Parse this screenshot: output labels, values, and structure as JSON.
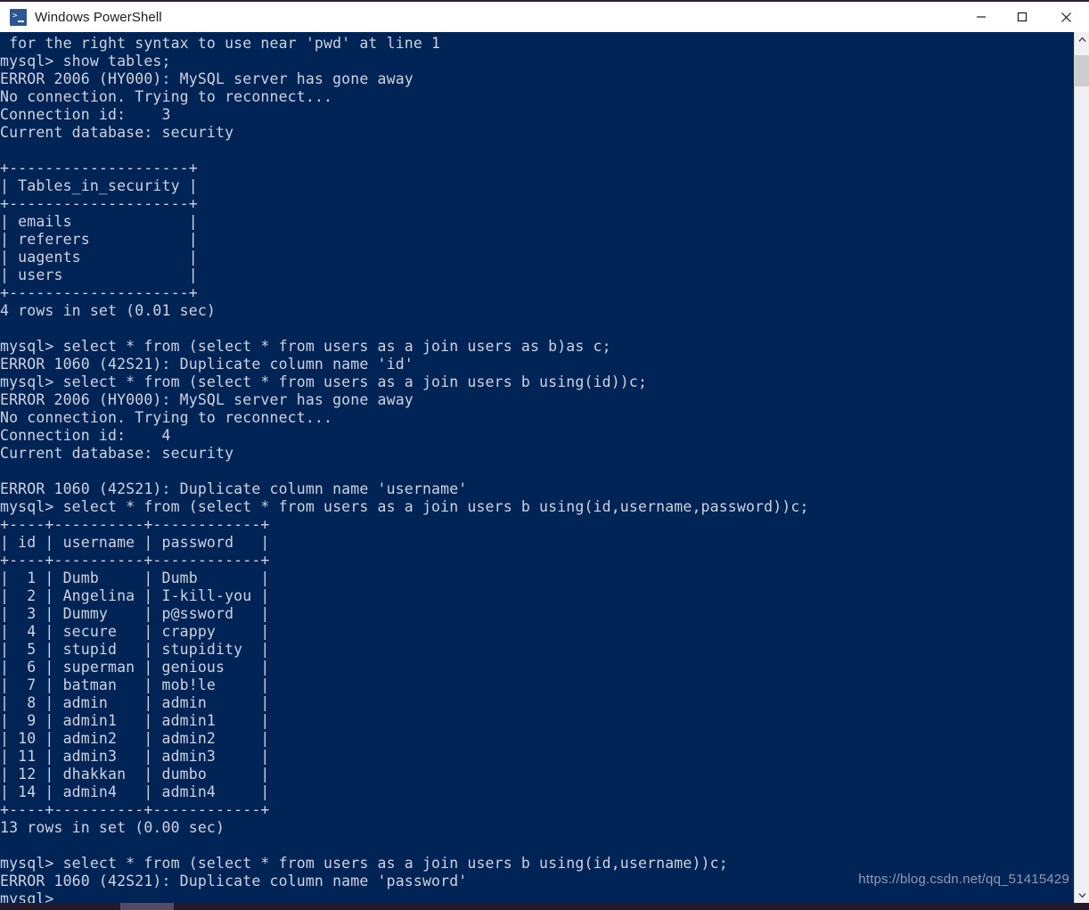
{
  "window": {
    "title": "Windows PowerShell",
    "icon": "powershell-icon",
    "controls": {
      "minimize": "—",
      "maximize": "□",
      "close": "✕"
    },
    "colors": {
      "console_background": "#012456",
      "console_text": "#cdd3de",
      "titlebar_background": "#ffffff",
      "icon_blue": "#2b5797"
    }
  },
  "console": {
    "lines": [
      " for the right syntax to use near 'pwd' at line 1",
      "mysql> show tables;",
      "ERROR 2006 (HY000): MySQL server has gone away",
      "No connection. Trying to reconnect...",
      "Connection id:    3",
      "Current database: security",
      "",
      "+--------------------+",
      "| Tables_in_security |",
      "+--------------------+",
      "| emails             |",
      "| referers           |",
      "| uagents            |",
      "| users              |",
      "+--------------------+",
      "4 rows in set (0.01 sec)",
      "",
      "mysql> select * from (select * from users as a join users as b)as c;",
      "ERROR 1060 (42S21): Duplicate column name 'id'",
      "mysql> select * from (select * from users as a join users b using(id))c;",
      "ERROR 2006 (HY000): MySQL server has gone away",
      "No connection. Trying to reconnect...",
      "Connection id:    4",
      "Current database: security",
      "",
      "ERROR 1060 (42S21): Duplicate column name 'username'",
      "mysql> select * from (select * from users as a join users b using(id,username,password))c;",
      "+----+----------+------------+",
      "| id | username | password   |",
      "+----+----------+------------+",
      "|  1 | Dumb     | Dumb       |",
      "|  2 | Angelina | I-kill-you |",
      "|  3 | Dummy    | p@ssword   |",
      "|  4 | secure   | crappy     |",
      "|  5 | stupid   | stupidity  |",
      "|  6 | superman | genious    |",
      "|  7 | batman   | mob!le     |",
      "|  8 | admin    | admin      |",
      "|  9 | admin1   | admin1     |",
      "| 10 | admin2   | admin2     |",
      "| 11 | admin3   | admin3     |",
      "| 12 | dhakkan  | dumbo      |",
      "| 14 | admin4   | admin4     |",
      "+----+----------+------------+",
      "13 rows in set (0.00 sec)",
      "",
      "mysql> select * from (select * from users as a join users b using(id,username))c;",
      "ERROR 1060 (42S21): Duplicate column name 'password'",
      "mysql>"
    ],
    "tables": [
      {
        "name": "show-tables-result",
        "headers": [
          "Tables_in_security"
        ],
        "rows": [
          [
            "emails"
          ],
          [
            "referers"
          ],
          [
            "uagents"
          ],
          [
            "users"
          ]
        ],
        "footer": "4 rows in set (0.01 sec)"
      },
      {
        "name": "users-join-result",
        "headers": [
          "id",
          "username",
          "password"
        ],
        "rows": [
          [
            "1",
            "Dumb",
            "Dumb"
          ],
          [
            "2",
            "Angelina",
            "I-kill-you"
          ],
          [
            "3",
            "Dummy",
            "p@ssword"
          ],
          [
            "4",
            "secure",
            "crappy"
          ],
          [
            "5",
            "stupid",
            "stupidity"
          ],
          [
            "6",
            "superman",
            "genious"
          ],
          [
            "7",
            "batman",
            "mob!le"
          ],
          [
            "8",
            "admin",
            "admin"
          ],
          [
            "9",
            "admin1",
            "admin1"
          ],
          [
            "10",
            "admin2",
            "admin2"
          ],
          [
            "11",
            "admin3",
            "admin3"
          ],
          [
            "12",
            "dhakkan",
            "dumbo"
          ],
          [
            "14",
            "admin4",
            "admin4"
          ]
        ],
        "footer": "13 rows in set (0.00 sec)"
      }
    ],
    "prompt": "mysql>"
  },
  "scrollbar": {
    "up_arrow": "⌃",
    "down_arrow": "⌄"
  },
  "watermark": {
    "text": "https://blog.csdn.net/qq_51415429"
  }
}
